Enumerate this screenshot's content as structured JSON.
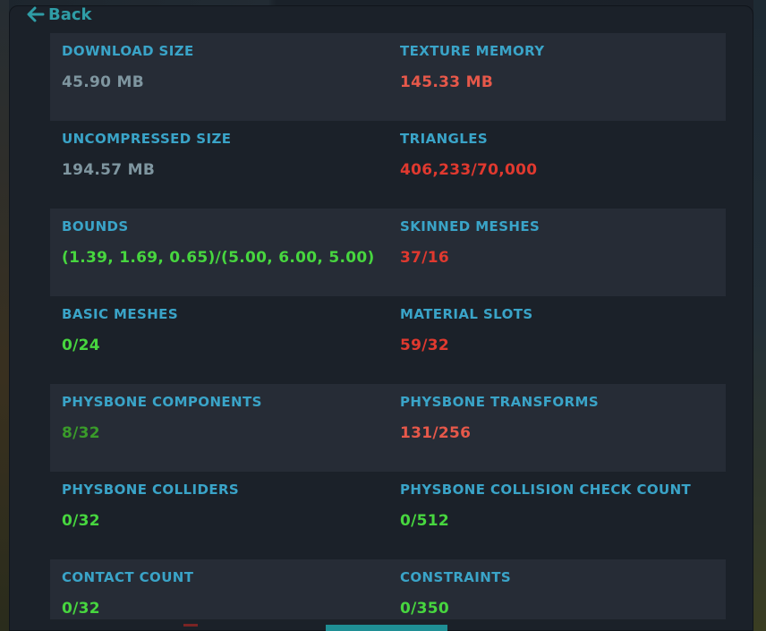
{
  "header": {
    "back_label": "Back"
  },
  "colors": {
    "label": "#3aa4c8",
    "neutral": "#7f96a0",
    "green": "#47d63f",
    "dark_green": "#3a9b2a",
    "red": "#e0392f",
    "light_red": "#e6584a",
    "accent": "#2f9da6"
  },
  "stats": [
    {
      "left": {
        "label": "DOWNLOAD SIZE",
        "value": "45.90 MB",
        "status": "neutral"
      },
      "right": {
        "label": "TEXTURE MEMORY",
        "value": "145.33 MB",
        "status": "light_red"
      }
    },
    {
      "left": {
        "label": "UNCOMPRESSED SIZE",
        "value": "194.57 MB",
        "status": "neutral"
      },
      "right": {
        "label": "TRIANGLES",
        "value": "406,233/70,000",
        "status": "red"
      }
    },
    {
      "left": {
        "label": "BOUNDS",
        "value": "(1.39, 1.69, 0.65)/(5.00, 6.00, 5.00)",
        "status": "green"
      },
      "right": {
        "label": "SKINNED MESHES",
        "value": "37/16",
        "status": "red"
      }
    },
    {
      "left": {
        "label": "BASIC MESHES",
        "value": "0/24",
        "status": "green"
      },
      "right": {
        "label": "MATERIAL SLOTS",
        "value": "59/32",
        "status": "red"
      }
    },
    {
      "left": {
        "label": "PHYSBONE COMPONENTS",
        "value": "8/32",
        "status": "dark_green"
      },
      "right": {
        "label": "PHYSBONE TRANSFORMS",
        "value": "131/256",
        "status": "light_red"
      }
    },
    {
      "left": {
        "label": "PHYSBONE COLLIDERS",
        "value": "0/32",
        "status": "green"
      },
      "right": {
        "label": "PHYSBONE COLLISION CHECK COUNT",
        "value": "0/512",
        "status": "green"
      }
    },
    {
      "left": {
        "label": "CONTACT COUNT",
        "value": "0/32",
        "status": "green"
      },
      "right": {
        "label": "CONSTRAINTS",
        "value": "0/350",
        "status": "green"
      }
    }
  ]
}
